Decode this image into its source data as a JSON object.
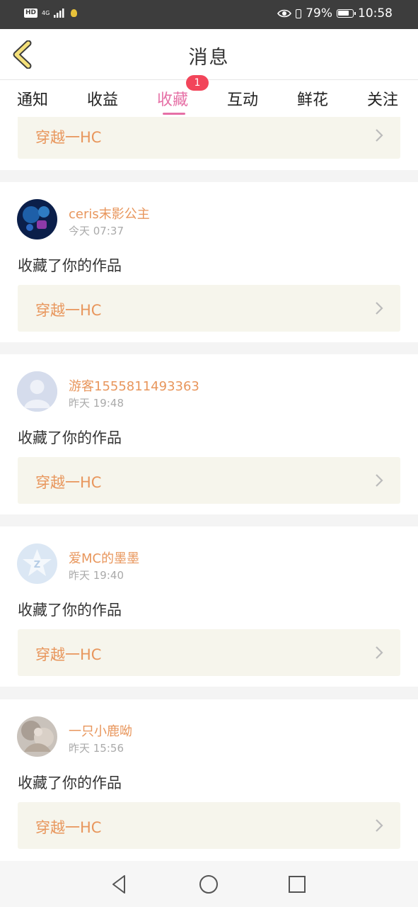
{
  "status_bar": {
    "hd": "HD",
    "network": "4G",
    "battery_percent": "79%",
    "time": "10:58"
  },
  "header": {
    "title": "消息"
  },
  "tabs": [
    {
      "label": "通知"
    },
    {
      "label": "收益"
    },
    {
      "label": "收藏",
      "active": true,
      "badge": "1"
    },
    {
      "label": "互动"
    },
    {
      "label": "鲜花"
    },
    {
      "label": "关注"
    }
  ],
  "messages": [
    {
      "work_title": "穿越一HC"
    },
    {
      "user": "ceris末影公主",
      "time": "今天 07:37",
      "action": "收藏了你的作品",
      "work_title": "穿越一HC",
      "avatar": "dark-game-avatar"
    },
    {
      "user": "游客1555811493363",
      "time": "昨天 19:48",
      "action": "收藏了你的作品",
      "work_title": "穿越一HC",
      "avatar": "default-person-avatar"
    },
    {
      "user": "爱MC的墨墨",
      "time": "昨天 19:40",
      "action": "收藏了你的作品",
      "work_title": "穿越一HC",
      "avatar": "qq-star-avatar"
    },
    {
      "user": "一只小鹿呦",
      "time": "昨天 15:56",
      "action": "收藏了你的作品",
      "work_title": "穿越一HC",
      "avatar": "anime-girl-avatar"
    }
  ],
  "colors": {
    "accent_pink": "#e670a6",
    "name_orange": "#e8965c",
    "badge_red": "#f2455a",
    "card_link_bg": "#f6f5ec"
  }
}
